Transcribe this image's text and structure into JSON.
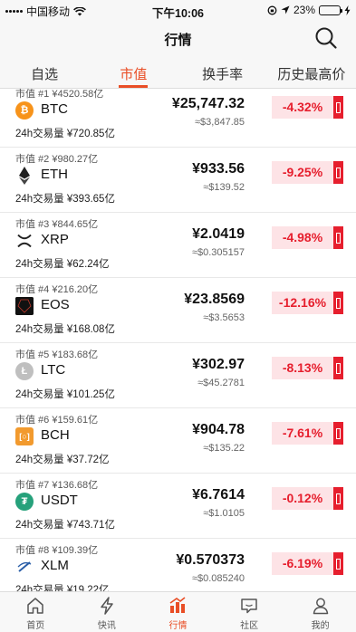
{
  "status_bar": {
    "carrier": "中国移动",
    "time": "下午10:06",
    "battery": "23%",
    "battery_level": 0.23
  },
  "nav": {
    "title": "行情"
  },
  "tabs": [
    {
      "label": "自选",
      "active": false
    },
    {
      "label": "市值",
      "active": true
    },
    {
      "label": "换手率",
      "active": false
    },
    {
      "label": "历史最高价",
      "active": false
    }
  ],
  "colors": {
    "accent": "#e94e26",
    "down": "#e61e2d",
    "down_bg": "#fde3e6"
  },
  "coins": [
    {
      "rank": "市值 #1 ¥4520.58亿",
      "symbol": "BTC",
      "volume": "24h交易量 ¥720.85亿",
      "price": "¥25,747.32",
      "usd": "≈$3,847.85",
      "change": "-4.32%",
      "icon": "bitcoin-icon",
      "icon_color": "#f7931a",
      "icon_glyph": "₿"
    },
    {
      "rank": "市值 #2 ¥980.27亿",
      "symbol": "ETH",
      "volume": "24h交易量 ¥393.65亿",
      "price": "¥933.56",
      "usd": "≈$139.52",
      "change": "-9.25%",
      "icon": "ethereum-icon",
      "icon_color": "#ffffff",
      "icon_glyph": ""
    },
    {
      "rank": "市值 #3 ¥844.65亿",
      "symbol": "XRP",
      "volume": "24h交易量 ¥62.24亿",
      "price": "¥2.0419",
      "usd": "≈$0.305157",
      "change": "-4.98%",
      "icon": "ripple-icon",
      "icon_color": "#ffffff",
      "icon_glyph": ""
    },
    {
      "rank": "市值 #4 ¥216.20亿",
      "symbol": "EOS",
      "volume": "24h交易量 ¥168.08亿",
      "price": "¥23.8569",
      "usd": "≈$3.5653",
      "change": "-12.16%",
      "icon": "eos-icon",
      "icon_color": "#111111",
      "icon_glyph": ""
    },
    {
      "rank": "市值 #5 ¥183.68亿",
      "symbol": "LTC",
      "volume": "24h交易量 ¥101.25亿",
      "price": "¥302.97",
      "usd": "≈$45.2781",
      "change": "-8.13%",
      "icon": "litecoin-icon",
      "icon_color": "#bfbfbf",
      "icon_glyph": "Ł"
    },
    {
      "rank": "市值 #6 ¥159.61亿",
      "symbol": "BCH",
      "volume": "24h交易量 ¥37.72亿",
      "price": "¥904.78",
      "usd": "≈$135.22",
      "change": "-7.61%",
      "icon": "bitcoin-cash-icon",
      "icon_color": "#f29a2e",
      "icon_glyph": "[○]"
    },
    {
      "rank": "市值 #7 ¥136.68亿",
      "symbol": "USDT",
      "volume": "24h交易量 ¥743.71亿",
      "price": "¥6.7614",
      "usd": "≈$1.0105",
      "change": "-0.12%",
      "icon": "tether-icon",
      "icon_color": "#26a17b",
      "icon_glyph": "₮"
    },
    {
      "rank": "市值 #8 ¥109.39亿",
      "symbol": "XLM",
      "volume": "24h交易量 ¥19.22亿",
      "price": "¥0.570373",
      "usd": "≈$0.085240",
      "change": "-6.19%",
      "icon": "stellar-icon",
      "icon_color": "#ffffff",
      "icon_glyph": ""
    }
  ],
  "tabbar": [
    {
      "label": "首页",
      "icon": "home-icon",
      "active": false
    },
    {
      "label": "快讯",
      "icon": "lightning-icon",
      "active": false
    },
    {
      "label": "行情",
      "icon": "market-chart-icon",
      "active": true
    },
    {
      "label": "社区",
      "icon": "chat-icon",
      "active": false
    },
    {
      "label": "我的",
      "icon": "user-icon",
      "active": false
    }
  ]
}
